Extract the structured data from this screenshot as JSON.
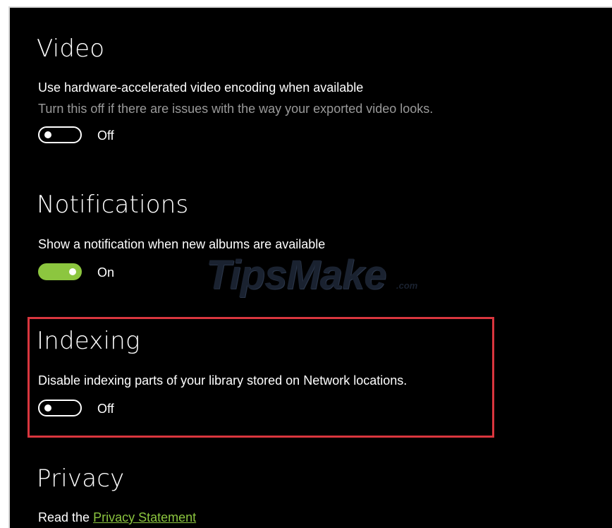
{
  "video": {
    "heading": "Video",
    "setting_label": "Use hardware-accelerated video encoding when available",
    "setting_description": "Turn this off if there are issues with the way your exported video looks.",
    "toggle_state": "Off",
    "toggle_on": false
  },
  "notifications": {
    "heading": "Notifications",
    "setting_label": "Show a notification when new albums are available",
    "toggle_state": "On",
    "toggle_on": true
  },
  "indexing": {
    "heading": "Indexing",
    "setting_label": "Disable indexing parts of your library stored on Network locations.",
    "toggle_state": "Off",
    "toggle_on": false
  },
  "privacy": {
    "heading": "Privacy",
    "read_prefix": "Read the",
    "link_text": "Privacy Statement"
  },
  "watermark": {
    "text": "TipsMake",
    "suffix": ".com"
  },
  "colors": {
    "accent": "#8cc63f",
    "highlight_border": "#d9363e",
    "background": "#000000"
  }
}
